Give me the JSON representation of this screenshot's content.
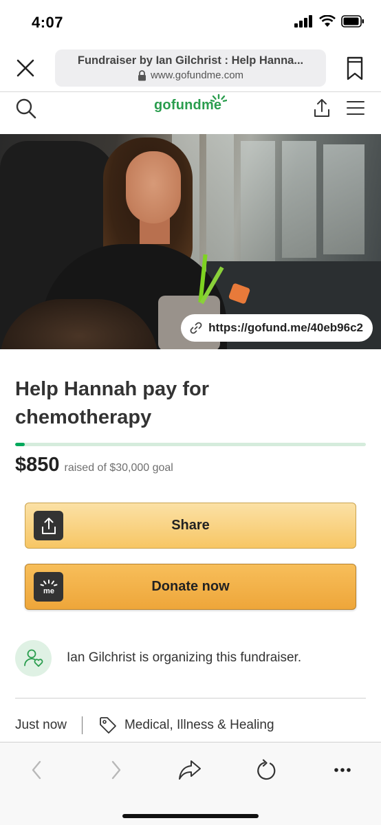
{
  "status_bar": {
    "time": "4:07"
  },
  "browser": {
    "page_title": "Fundraiser by Ian Gilchrist : Help Hanna...",
    "domain": "www.gofundme.com"
  },
  "site_header": {
    "logo_text": "gofundme"
  },
  "hero": {
    "short_link": "https://gofund.me/40eb96c2"
  },
  "fundraiser": {
    "title": "Help Hannah pay for chemotherapy",
    "raised_amount": "$850",
    "goal_text": "raised of $30,000 goal",
    "progress_fraction": 0.028
  },
  "actions": {
    "share_label": "Share",
    "donate_label": "Donate now"
  },
  "organizer": {
    "text": "Ian Gilchrist is organizing this fundraiser."
  },
  "meta": {
    "time": "Just now",
    "category": "Medical, Illness & Healing"
  },
  "colors": {
    "brand_green": "#02a95c",
    "share_button": "#f7c664",
    "donate_button": "#eea63a"
  },
  "icons": {
    "close": "close-icon",
    "bookmark": "bookmark-icon",
    "search": "search-icon",
    "share": "share-icon",
    "menu": "hamburger-menu-icon",
    "link": "link-icon",
    "organizer": "person-heart-icon",
    "category": "tag-icon",
    "back": "chevron-left-icon",
    "forward": "chevron-right-icon",
    "browser_share": "share-arrow-icon",
    "reload": "reload-icon",
    "more": "more-dots-icon"
  }
}
